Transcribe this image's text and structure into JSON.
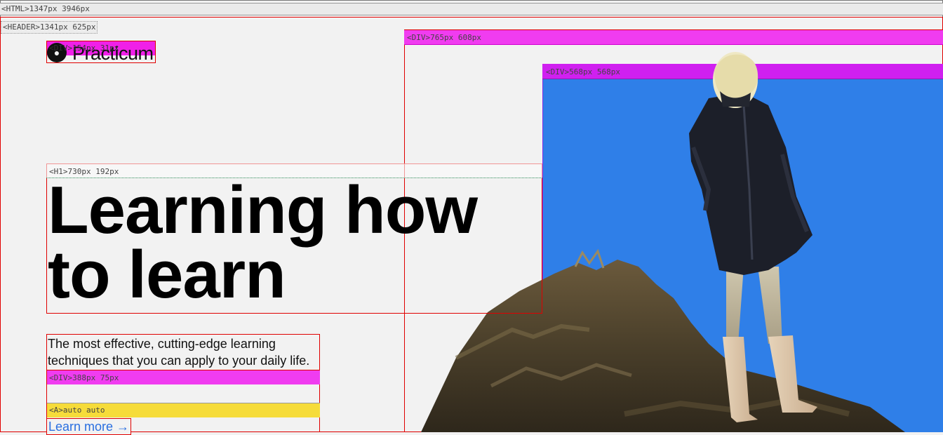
{
  "debug": {
    "html_tag": "<HTML>1347px 3946px",
    "header_tag": "<HEADER>1341px 625px",
    "logo_tag": "<DIV>154px 31px",
    "media_col_tag": "<DIV>765px 608px",
    "image_box_tag": "<DIV>568px 568px",
    "h1_tag": "<H1>730px 192px",
    "cta_tag": "<DIV>388px 75px",
    "link_tag": "<A>auto auto"
  },
  "logo": {
    "text": "Practicum",
    "icon": "practicum-logo-icon"
  },
  "hero": {
    "title": "Learning how to learn",
    "description": "The most effective, cutting-edge learning techniques that you can apply to your daily life.",
    "cta_label": "Learn more →"
  },
  "colors": {
    "background": "#f2f2f2",
    "image_box": "#2f7fe8",
    "link": "#2a6fe0",
    "debug_magenta": "#f03cf0",
    "debug_yellow": "#f6dc3a"
  }
}
